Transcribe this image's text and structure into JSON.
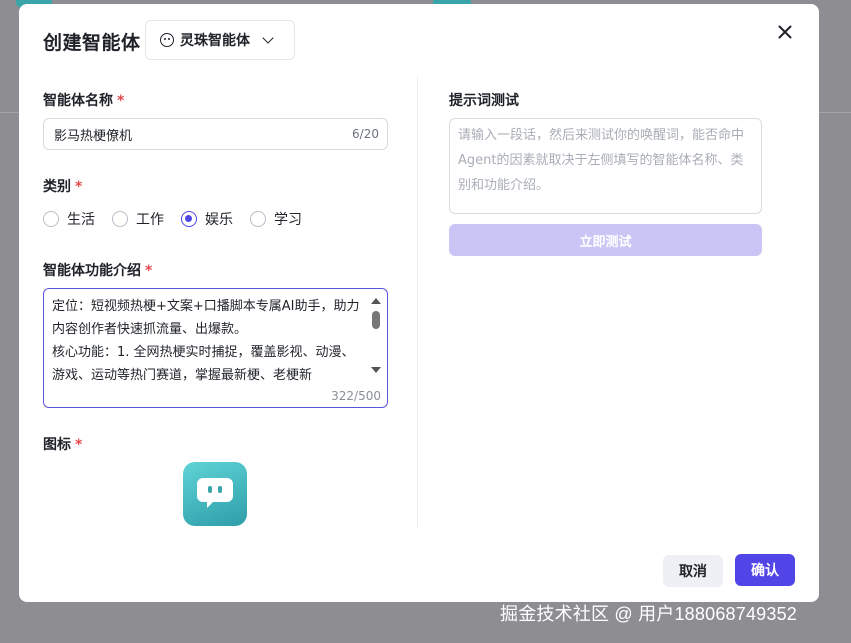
{
  "dialog": {
    "title": "创建智能体",
    "agent_type": "灵珠智能体"
  },
  "form": {
    "name": {
      "label": "智能体名称",
      "required_mark": "*",
      "value": "影马热梗僚机",
      "count": "6/20"
    },
    "category": {
      "label": "类别",
      "required_mark": "*",
      "options": [
        "生活",
        "工作",
        "娱乐",
        "学习"
      ],
      "selected": "娱乐"
    },
    "description": {
      "label": "智能体功能介绍",
      "required_mark": "*",
      "value": "定位：短视频热梗+文案+口播脚本专属AI助手，助力内容创作者快速抓流量、出爆款。\n核心功能：1. 全网热梗实时捕捉，覆盖影视、动漫、游戏、运动等热门赛道，掌握最新梗、老梗新",
      "count": "322/500"
    },
    "icon": {
      "label": "图标",
      "required_mark": "*"
    }
  },
  "prompt_test": {
    "title": "提示词测试",
    "placeholder": "请输入一段话，然后来测试你的唤醒词，能否命中Agent的因素就取决于左侧填写的智能体名称、类别和功能介绍。",
    "test_button": "立即测试"
  },
  "footer": {
    "cancel": "取消",
    "confirm": "确认"
  },
  "watermark": "掘金技术社区 @ 用户188068749352",
  "colors": {
    "primary": "#5145e8",
    "required": "#e5484d",
    "disabled_button": "#c9c6f6",
    "icon_gradient_top": "#5fd3d6",
    "icon_gradient_bottom": "#2e9ea9"
  }
}
